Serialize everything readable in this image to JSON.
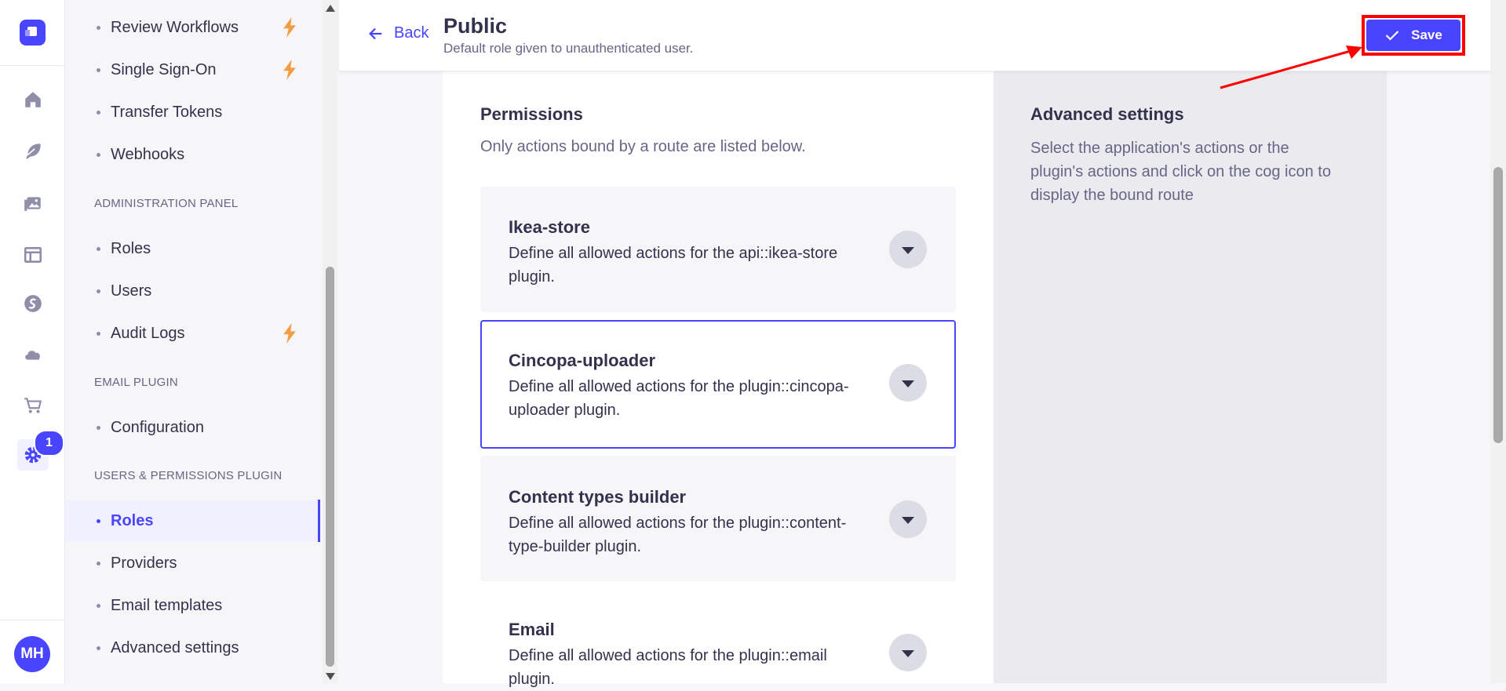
{
  "rail": {
    "notification_count": "1",
    "avatar_initials": "MH",
    "icons": [
      "home-icon",
      "feather-icon",
      "media-library-icon",
      "layout-icon",
      "plugin-s-icon",
      "cloud-icon",
      "cart-icon",
      "gear-icon"
    ]
  },
  "subnav": {
    "items_top": [
      {
        "label": "Review Workflows",
        "premium": true
      },
      {
        "label": "Single Sign-On",
        "premium": true
      },
      {
        "label": "Transfer Tokens",
        "premium": false
      },
      {
        "label": "Webhooks",
        "premium": false
      }
    ],
    "section_admin": "ADMINISTRATION PANEL",
    "items_admin": [
      {
        "label": "Roles"
      },
      {
        "label": "Users"
      },
      {
        "label": "Audit Logs",
        "premium": true
      }
    ],
    "section_email": "EMAIL PLUGIN",
    "items_email": [
      {
        "label": "Configuration"
      }
    ],
    "section_users": "USERS & PERMISSIONS PLUGIN",
    "items_users": [
      {
        "label": "Roles",
        "active": true
      },
      {
        "label": "Providers"
      },
      {
        "label": "Email templates"
      },
      {
        "label": "Advanced settings"
      }
    ]
  },
  "header": {
    "back_label": "Back",
    "title": "Public",
    "subtitle": "Default role given to unauthenticated user.",
    "save_label": "Save"
  },
  "permissions": {
    "title": "Permissions",
    "subtitle": "Only actions bound by a route are listed below.",
    "accordions": [
      {
        "title": "Ikea-store",
        "desc": "Define all allowed actions for the api::ikea-store plugin."
      },
      {
        "title": "Cincopa-uploader",
        "desc": "Define all allowed actions for the plugin::cincopa-uploader plugin."
      },
      {
        "title": "Content types builder",
        "desc": "Define all allowed actions for the plugin::content-type-builder plugin."
      },
      {
        "title": "Email",
        "desc": "Define all allowed actions for the plugin::email plugin."
      }
    ]
  },
  "advanced": {
    "title": "Advanced settings",
    "desc": "Select the application's actions or the plugin's actions and click on the cog icon to display the bound route"
  },
  "colors": {
    "primary": "#4945ff",
    "annotation_red": "#ff0000",
    "premium_bolt": "#f29d41"
  }
}
